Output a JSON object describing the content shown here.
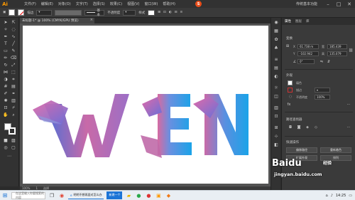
{
  "app": {
    "logo": "Ai",
    "workspace": "传统基本功能",
    "menu": [
      "文件(F)",
      "编辑(E)",
      "对象(O)",
      "文字(T)",
      "选择(S)",
      "效果(C)",
      "视图(V)",
      "窗口(W)",
      "帮助(H)"
    ],
    "badge": "S"
  },
  "controlbar": {
    "stroke_label": "描边",
    "stroke_preview_label": "基本",
    "opacity_label": "不透明度",
    "style_label": "样式"
  },
  "document": {
    "tab_title": "未标题-1* @ 100% (CMYK/GPU 预览)",
    "zoom": "100%",
    "artboard_number": "1",
    "status_tool": "选择"
  },
  "artwork": {
    "letters": [
      "W",
      "E",
      "N"
    ],
    "gradient_start": "#4a6fd8",
    "gradient_mid": "#c86aa8",
    "gradient_end": "#1aa3e8"
  },
  "properties": {
    "tabs": [
      "属性",
      "图层",
      "库"
    ],
    "section_transform": "变换",
    "x_label": "X",
    "x_value": "61.738 m",
    "y_label": "Y",
    "y_value": "-102.942",
    "w_label": "宽",
    "w_value": "185.439",
    "h_label": "高",
    "h_value": "135.079",
    "angle_value": "0°",
    "section_appearance": "外观",
    "fill_label": "填色",
    "stroke_label": "描边",
    "opacity_label": "不透明度",
    "opacity_value": "100%",
    "section_align": "路径查找器",
    "section_quick": "快速操作",
    "btn_offset": "偏移路径",
    "btn_recolor": "重新着色",
    "btn_expand": "扩展外观",
    "btn_rearrange": "排列"
  },
  "watermark": {
    "brand": "Baidu",
    "sub": "经验",
    "url": "jingyan.baidu.com"
  },
  "taskbar": {
    "search_placeholder": "在这里输入你要搜索的内容",
    "task1": "明明不想再面对怎么办",
    "task2": "新建一个",
    "time": "14:25"
  }
}
